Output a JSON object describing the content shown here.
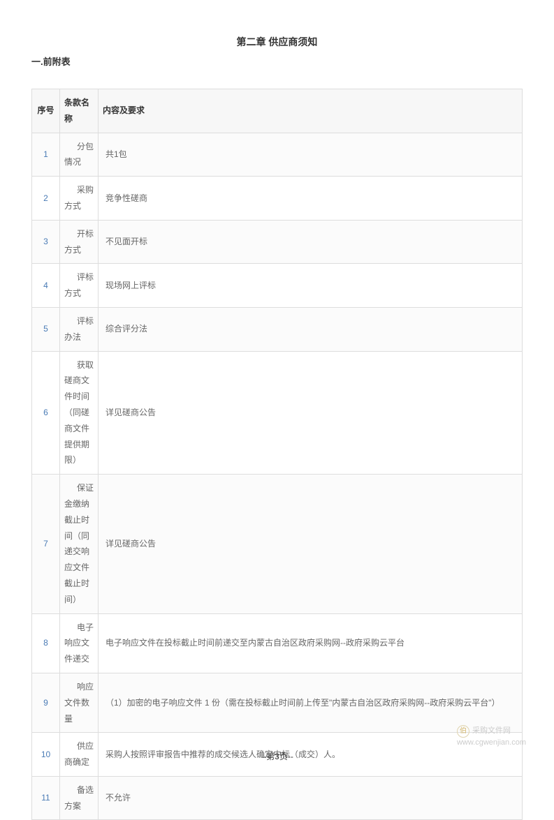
{
  "chapter_title": "第二章 供应商须知",
  "section_title": "一.前附表",
  "table": {
    "headers": {
      "num": "序号",
      "name": "条款名称",
      "content": "内容及要求"
    },
    "rows": [
      {
        "num": "1",
        "name": "分包情况",
        "content": "共1包"
      },
      {
        "num": "2",
        "name": "采购方式",
        "content": "竞争性磋商"
      },
      {
        "num": "3",
        "name": "开标方式",
        "content": "不见面开标"
      },
      {
        "num": "4",
        "name": "评标方式",
        "content": "现场网上评标"
      },
      {
        "num": "5",
        "name": "评标办法",
        "content": "综合评分法"
      },
      {
        "num": "6",
        "name": "获取磋商文件时间（同磋商文件提供期限）",
        "content": "详见磋商公告"
      },
      {
        "num": "7",
        "name": "保证金缴纳截止时间（同递交响应文件截止时间）",
        "content": "详见磋商公告"
      },
      {
        "num": "8",
        "name": "电子响应文件递交",
        "content": "电子响应文件在投标截止时间前递交至内蒙古自治区政府采购网--政府采购云平台"
      },
      {
        "num": "9",
        "name": "响应文件数量",
        "content": "（1）加密的电子响应文件 1 份（需在投标截止时间前上传至\"内蒙古自治区政府采购网--政府采购云平台\"）"
      },
      {
        "num": "10",
        "name": "供应商确定",
        "content": "采购人按照评审报告中推荐的成交候选人确定中标（成交）人。"
      },
      {
        "num": "11",
        "name": "备选方案",
        "content": "不允许"
      }
    ]
  },
  "watermark": {
    "icon_char": "伯",
    "cn": "采购文件网",
    "url": "www.cgwenjian.com"
  },
  "page_footer": "--第3页--"
}
